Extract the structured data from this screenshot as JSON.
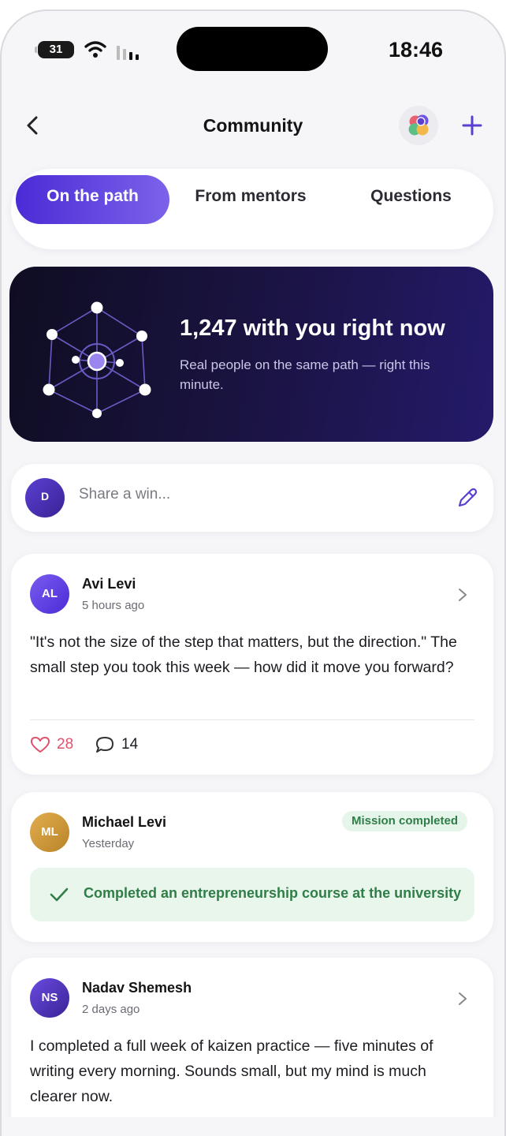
{
  "status_bar": {
    "battery": "31",
    "time": "18:46"
  },
  "nav": {
    "title": "Community"
  },
  "tabs": [
    {
      "label": "On the path",
      "active": true
    },
    {
      "label": "From mentors",
      "active": false
    },
    {
      "label": "Questions",
      "active": false
    }
  ],
  "hero": {
    "title": "1,247 with you right now",
    "subtitle": "Real people on the same path — right this minute."
  },
  "composer": {
    "avatar_initial": "D",
    "placeholder": "Share a win..."
  },
  "posts": [
    {
      "initials": "AL",
      "author": "Avi Levi",
      "time": "5 hours ago",
      "text": "\"It's not the size of the step that matters, but the direction.\" The small step you took this week — how did it move you forward?",
      "likes": "28",
      "comments": "14"
    },
    {
      "initials": "ML",
      "author": "Michael Levi",
      "time": "Yesterday",
      "badge": "Mission completed",
      "mission": "Completed an entrepreneurship course at the university"
    },
    {
      "initials": "NS",
      "author": "Nadav Shemesh",
      "time": "2 days ago",
      "text": "I completed a full week of kaizen practice — five minutes of writing every morning. Sounds small, but my mind is much clearer now."
    }
  ],
  "colors": {
    "accent": "#5b3fd1",
    "like": "#e0526b",
    "success": "#2f7d47",
    "hero_bg": "#1b1445"
  },
  "icons": [
    "back-chevron-icon",
    "plus-icon",
    "pencil-icon",
    "heart-icon",
    "comment-icon",
    "chevron-right-icon",
    "check-icon",
    "network-icon",
    "wifi-icon",
    "signal-icon"
  ]
}
